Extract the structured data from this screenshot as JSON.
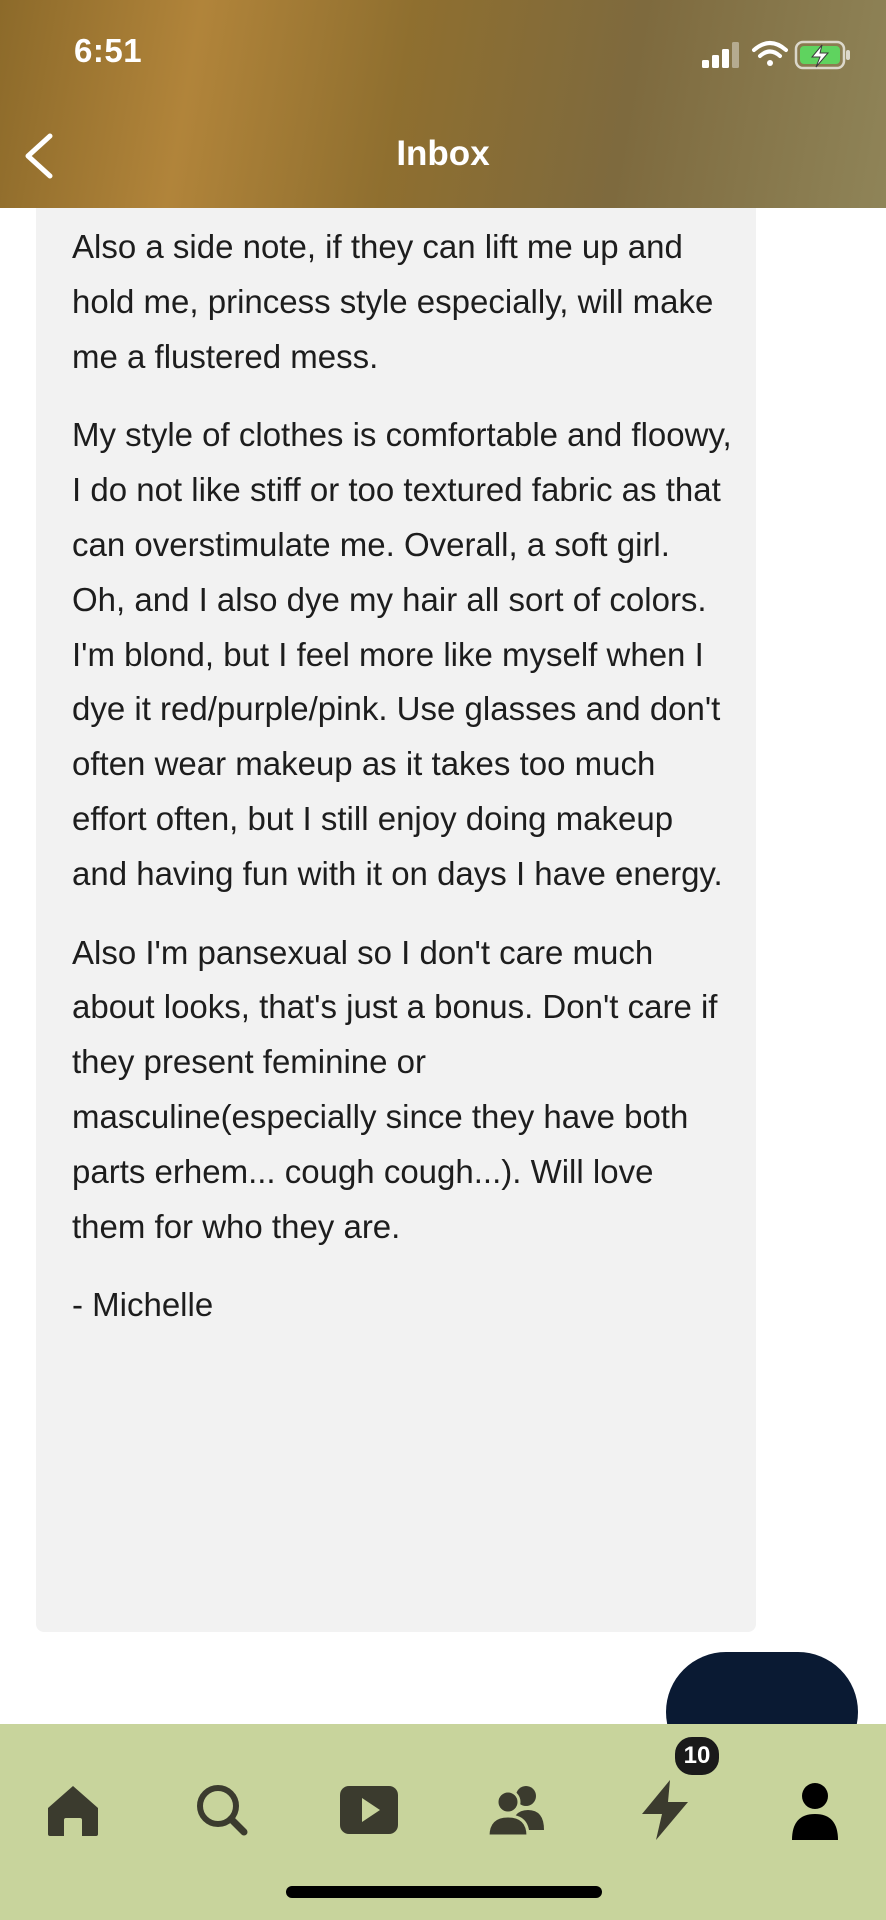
{
  "status_bar": {
    "time": "6:51"
  },
  "header": {
    "title": "Inbox",
    "back_icon": "chevron-left-icon"
  },
  "message": {
    "paragraphs": [
      "Also a side note, if they can lift me up and hold me, princess style especially, will make me a flustered mess.",
      "My style of clothes is comfortable and floowy, I do not like stiff or too textured fabric as that can overstimulate me. Overall, a soft girl. Oh, and I also dye my hair all sort of colors. I'm blond, but I feel more like myself when I dye it red/purple/pink. Use glasses and don't often wear makeup as it takes too much effort often, but I still enjoy doing makeup and having fun with it on days I have energy.",
      "Also I'm pansexual so I don't care much about looks, that's just a bonus. Don't care if they present feminine or masculine(especially since they have both parts erhem... cough cough...). Will love them for who they are."
    ],
    "signature": "- Michelle"
  },
  "tab_bar": {
    "items": [
      {
        "icon": "home-icon"
      },
      {
        "icon": "search-icon"
      },
      {
        "icon": "play-icon"
      },
      {
        "icon": "people-icon"
      },
      {
        "icon": "lightning-icon",
        "badge": "10"
      },
      {
        "icon": "account-icon"
      }
    ]
  },
  "colors": {
    "tab_bar_bg": "#c8d49c",
    "fab_bg": "#0a1a33",
    "card_bg": "#f2f2f2"
  }
}
